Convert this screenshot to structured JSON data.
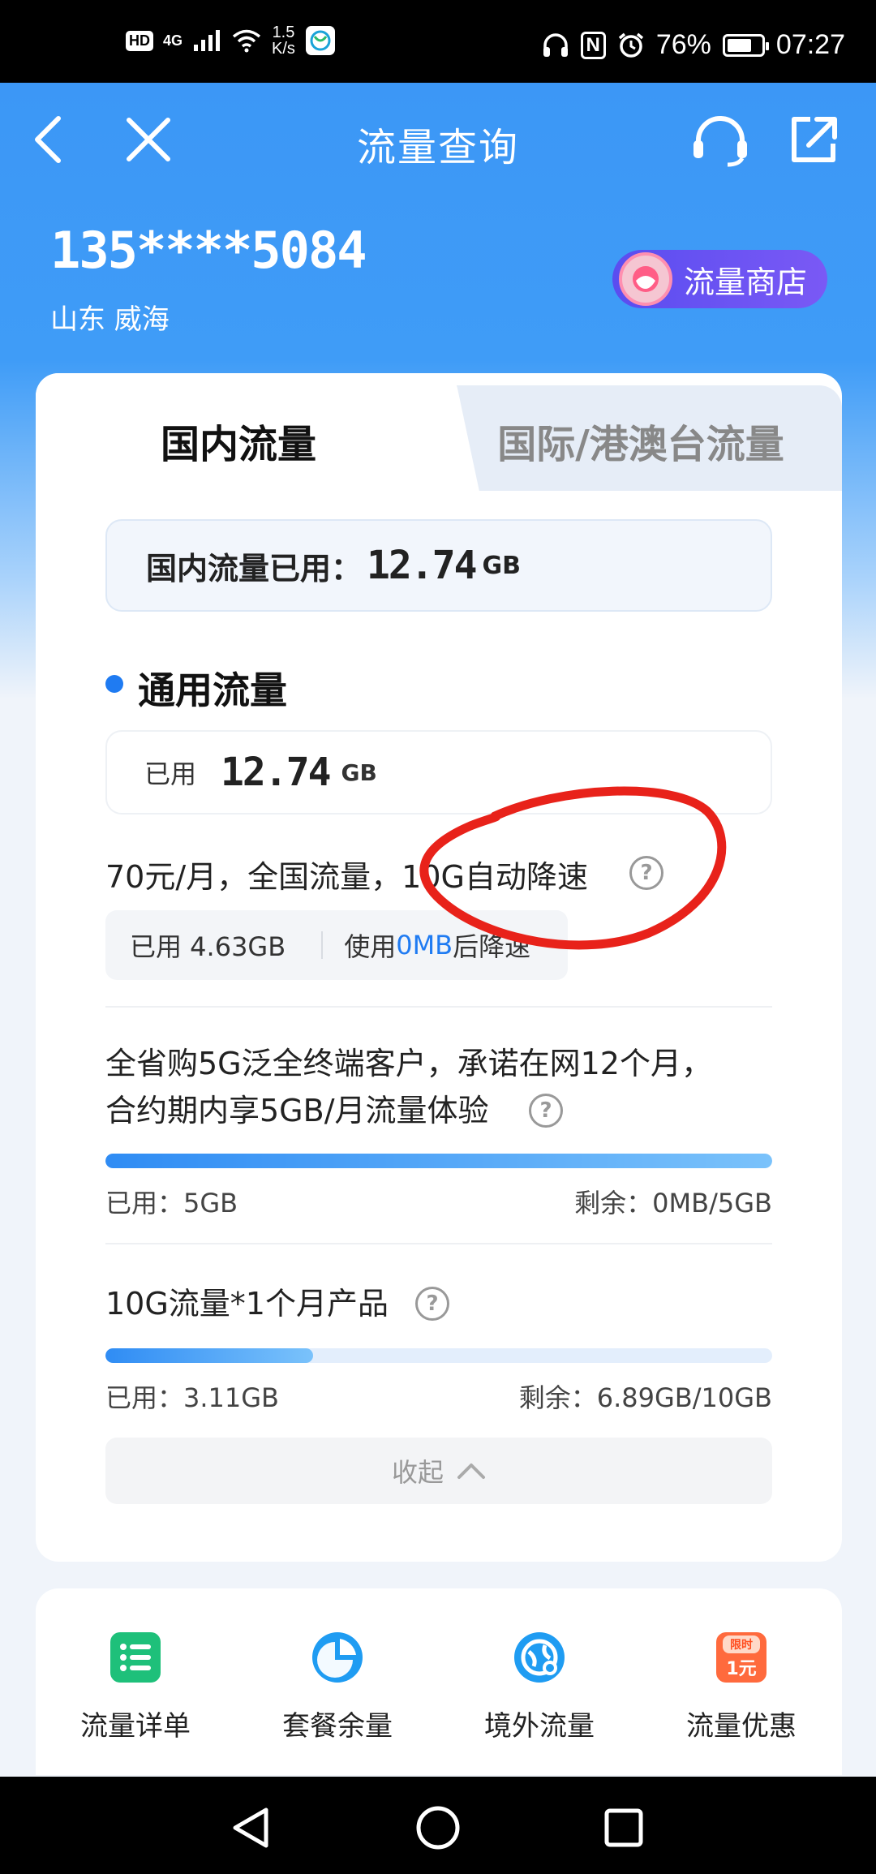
{
  "status_bar": {
    "hd": "HD",
    "network": "4G",
    "speed_value": "1.5",
    "speed_unit": "K/s",
    "nfc": "N",
    "battery_percent": "76%",
    "time": "07:27",
    "battery_level": 0.76
  },
  "nav": {
    "title": "流量查询",
    "back_icon": "chevron-left-icon",
    "close_icon": "close-icon",
    "service_icon": "headset-icon",
    "share_icon": "share-icon"
  },
  "account": {
    "phone": "135****5084",
    "region": "山东 威海",
    "shop_label": "流量商店"
  },
  "tabs": [
    {
      "label": "国内流量",
      "active": true
    },
    {
      "label": "国际/港澳台流量",
      "active": false
    }
  ],
  "summary": {
    "label": "国内流量已用：",
    "value": "12.74",
    "unit": "GB"
  },
  "general": {
    "title": "通用流量",
    "used_label": "已用",
    "used_value": "12.74",
    "used_unit": "GB"
  },
  "plan": {
    "title": "70元/月，全国流量，10G自动降速",
    "used": "已用  4.63GB",
    "throttle_prefix": "使用",
    "throttle_value": "0MB",
    "throttle_suffix": "后降速"
  },
  "packages": [
    {
      "title_line1": "全省购5G泛全终端客户，承诺在网12个月，",
      "title_line2": "合约期内享5GB/月流量体验",
      "used": "已用：5GB",
      "remaining": "剩余：0MB/5GB",
      "progress": 1.0
    },
    {
      "title_line1": "10G流量*1个月产品",
      "used": "已用：3.11GB",
      "remaining": "剩余：6.89GB/10GB",
      "progress": 0.311
    }
  ],
  "collapse_label": "收起",
  "shortcuts": [
    {
      "label": "流量详单",
      "icon": "list-icon",
      "color": "#1ec07a"
    },
    {
      "label": "套餐余量",
      "icon": "pie-chart-icon",
      "color": "#1f9cf2"
    },
    {
      "label": "境外流量",
      "icon": "globe-plane-icon",
      "color": "#1f9cf2"
    },
    {
      "label": "流量优惠",
      "icon": "limited-offer-icon",
      "color": "#ff6a3d",
      "badge_top": "限时",
      "badge_bottom": "1元"
    }
  ],
  "colors": {
    "brand_blue": "#3c97f6",
    "accent_blue": "#1f7bf2",
    "annotation_red": "#e8221a"
  }
}
